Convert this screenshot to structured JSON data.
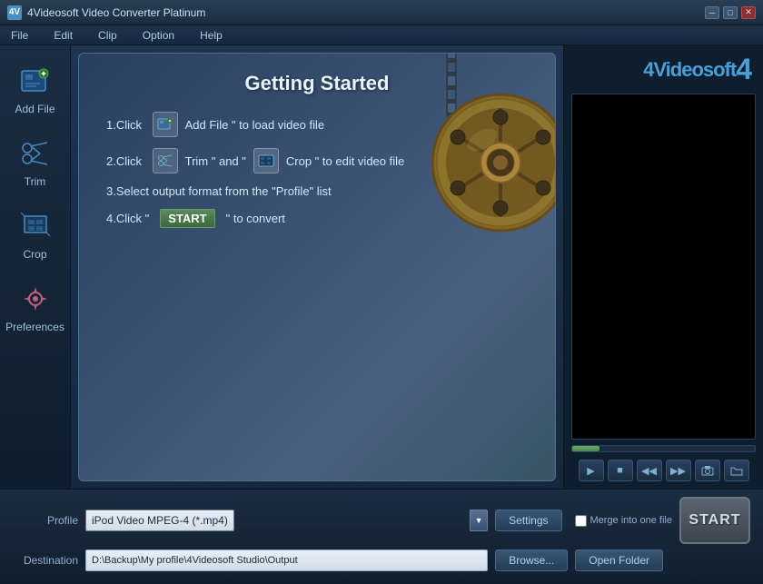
{
  "titlebar": {
    "icon_label": "4V",
    "title": "4Videosoft Video Converter Platinum",
    "minimize": "─",
    "maximize": "□",
    "close": "✕"
  },
  "menubar": {
    "items": [
      "File",
      "Edit",
      "Clip",
      "Option",
      "Help"
    ]
  },
  "sidebar": {
    "items": [
      {
        "id": "add-file",
        "label": "Add File",
        "icon": "film-icon"
      },
      {
        "id": "trim",
        "label": "Trim",
        "icon": "scissors-icon"
      },
      {
        "id": "crop",
        "label": "Crop",
        "icon": "crop-icon"
      },
      {
        "id": "preferences",
        "label": "Preferences",
        "icon": "heart-icon"
      }
    ]
  },
  "getting_started": {
    "title": "Getting Started",
    "steps": [
      {
        "num": "1",
        "text_before": ".Click ",
        "icon": "film-small-icon",
        "text_after": " Add File \" to load video file"
      },
      {
        "num": "2",
        "text_before": ".Click ",
        "icon": "scissors-small-icon",
        "text_after": " Trim \" and \"",
        "icon2": "crop-small-icon",
        "text_after2": " Crop \" to edit video file"
      },
      {
        "num": "3",
        "text": ".Select output format from the \"Profile\" list"
      },
      {
        "num": "4",
        "text_before": ".Click \"",
        "badge": "START",
        "text_after": " \" to convert"
      }
    ]
  },
  "preview": {
    "brand": "4Videosoft",
    "brand_num": "4",
    "progress": 15
  },
  "controls": {
    "play": "▶",
    "stop": "■",
    "rewind": "◀◀",
    "forward": "▶▶",
    "snapshot": "📷",
    "folder": "📁"
  },
  "bottombar": {
    "profile_label": "Profile",
    "profile_value": "iPod Video MPEG-4 (*.mp4)",
    "settings_label": "Settings",
    "merge_label": "Merge into one file",
    "destination_label": "Destination",
    "destination_value": "D:\\Backup\\My profile\\4Videosoft Studio\\Output",
    "browse_label": "Browse...",
    "open_folder_label": "Open Folder",
    "start_label": "START"
  }
}
